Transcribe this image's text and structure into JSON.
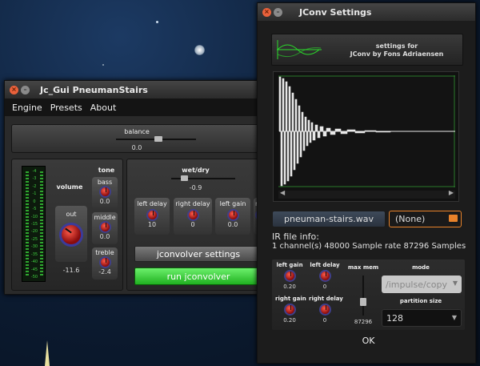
{
  "jcgui": {
    "title": "Jc_Gui PneumanStairs",
    "menu": [
      "Engine",
      "Presets",
      "About"
    ],
    "balance": {
      "label": "balance",
      "value": "0.0"
    },
    "volume": {
      "label": "volume",
      "knob_label": "out",
      "value": "-11.6"
    },
    "meter_scale": [
      "-4",
      "-3",
      "-2",
      "-1",
      "0",
      "-5",
      "-10",
      "-15",
      "-20",
      "-25",
      "-30",
      "-35",
      "-40",
      "-45",
      "-50"
    ],
    "tone": {
      "label": "tone",
      "bass": {
        "label": "bass",
        "value": "0.0"
      },
      "middle": {
        "label": "middle",
        "value": "0.0"
      },
      "treble": {
        "label": "treble",
        "value": "-2.4"
      }
    },
    "wetdry": {
      "label": "wet/dry",
      "value": "-0.9"
    },
    "mini_knobs": [
      {
        "label": "left delay",
        "value": "10"
      },
      {
        "label": "right delay",
        "value": "0"
      },
      {
        "label": "left gain",
        "value": "0.0"
      },
      {
        "label": "ri",
        "value": ""
      }
    ],
    "settings_button": "jconvolver settings",
    "run_button": "run jconvolver"
  },
  "jconv": {
    "title": "JConv Settings",
    "header_line1": "settings for",
    "header_line2": "JConv  by  Fons Adriaensen",
    "filename": "pneuman-stairs.wav",
    "file_select": "(None)",
    "ir_info_label": "IR file info:",
    "ir_info": "1 channel(s) 48000 Sample rate 87296 Samples",
    "left_gain": {
      "label": "left gain",
      "value": "0.20"
    },
    "left_delay": {
      "label": "left delay",
      "value": "0"
    },
    "right_gain": {
      "label": "right gain",
      "value": "0.20"
    },
    "right_delay": {
      "label": "right delay",
      "value": "0"
    },
    "max_mem": {
      "label": "max mem",
      "value": "87296"
    },
    "mode": {
      "label": "mode",
      "value": "/impulse/copy"
    },
    "partition": {
      "label": "partition size",
      "value": "128"
    },
    "ok": "OK"
  },
  "colors": {
    "accent_green": "#3cdc3c",
    "knob_red": "#c41414",
    "orange_border": "#e8822a"
  }
}
